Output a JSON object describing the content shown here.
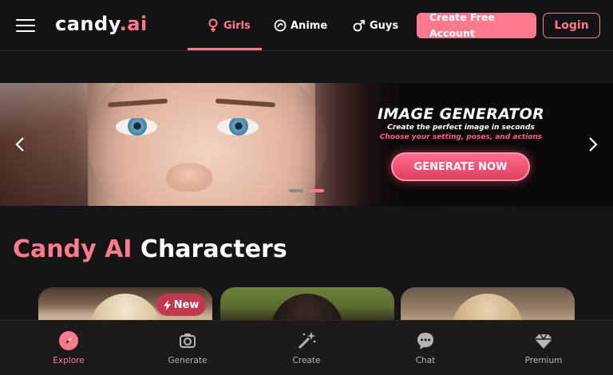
{
  "header": {
    "logo_main": "candy",
    "logo_accent": ".ai",
    "tabs": [
      {
        "label": "Girls",
        "icon": "female-icon",
        "active": true
      },
      {
        "label": "Anime",
        "icon": "anime-icon",
        "active": false
      },
      {
        "label": "Guys",
        "icon": "male-icon",
        "active": false
      }
    ],
    "create_account_label": "Create Free Account",
    "login_label": "Login"
  },
  "banner": {
    "title": "IMAGE GENERATOR",
    "subtitle": "Create the perfect image in seconds",
    "tagline": "Choose your setting, poses, and actions",
    "cta_label": "GENERATE NOW",
    "slides_total": 2,
    "active_slide": 2
  },
  "section": {
    "title_brand": "Candy AI",
    "title_rest": " Characters"
  },
  "cards": [
    {
      "badge": "New"
    },
    {
      "badge": ""
    },
    {
      "badge": ""
    }
  ],
  "bottom_nav": [
    {
      "label": "Explore",
      "icon": "compass-icon",
      "active": true
    },
    {
      "label": "Generate",
      "icon": "generate-icon",
      "active": false
    },
    {
      "label": "Create",
      "icon": "magic-wand-icon",
      "active": false
    },
    {
      "label": "Chat",
      "icon": "chat-bubble-icon",
      "active": false
    },
    {
      "label": "Premium",
      "icon": "diamond-icon",
      "active": false
    }
  ],
  "colors": {
    "accent": "#ff7a8c",
    "background": "#151515",
    "cta_gradient_top": "#ff6b8f",
    "cta_gradient_bottom": "#e0405f",
    "badge_bg": "#c0394f"
  }
}
